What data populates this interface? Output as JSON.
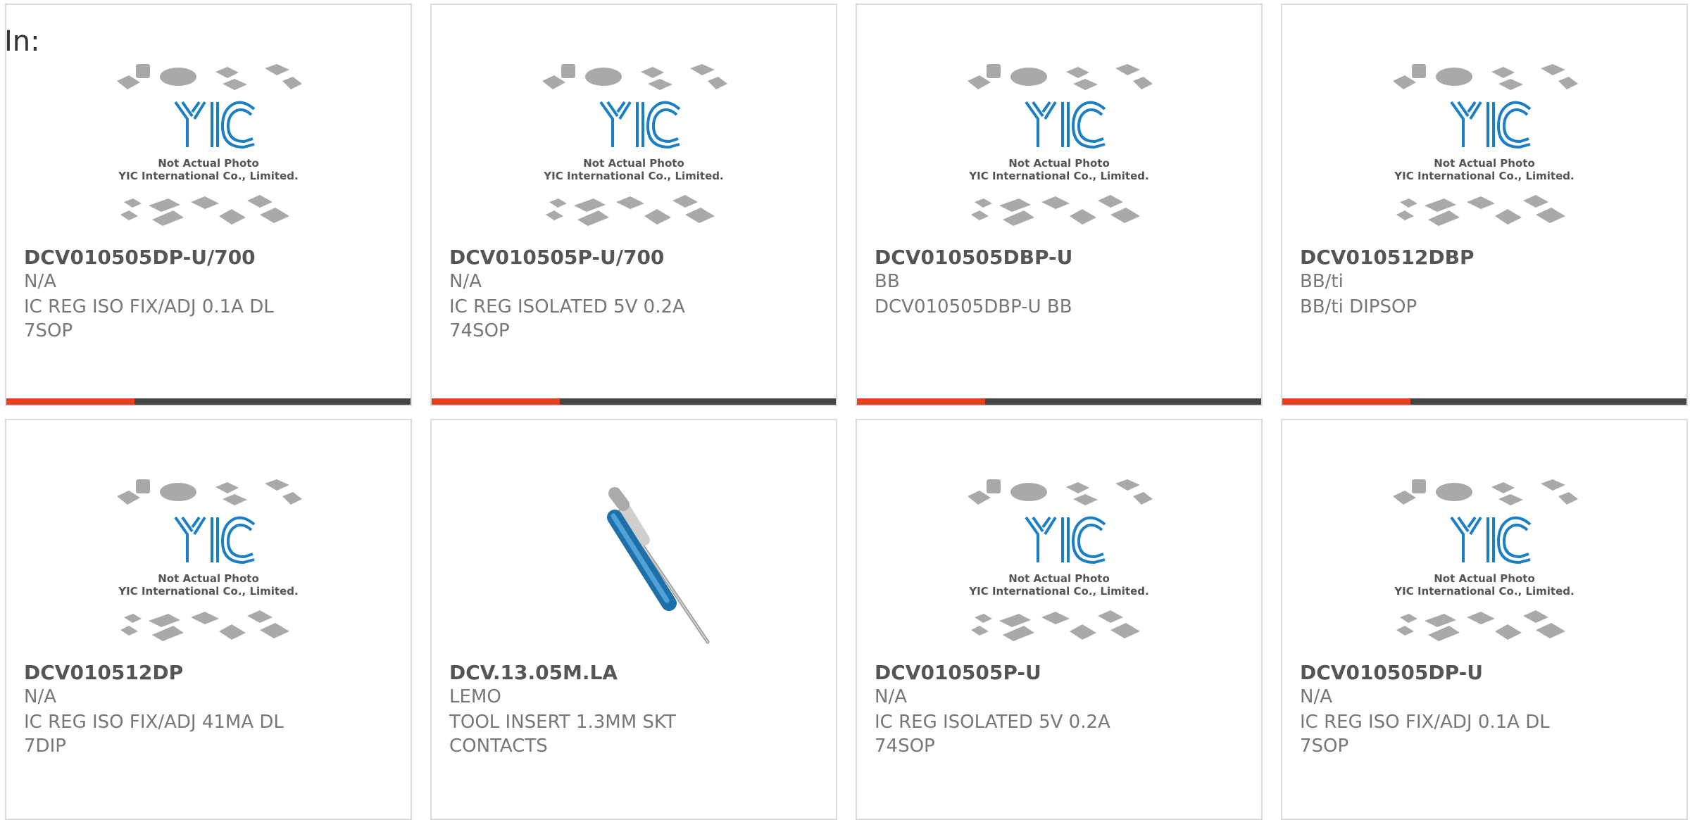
{
  "header": {
    "in_label": "In:"
  },
  "placeholder": {
    "line1": "Not Actual Photo",
    "line2": "YIC International Co., Limited."
  },
  "colors": {
    "accent": "#e6401d",
    "bar": "#444444",
    "border": "#dcdcdc",
    "logo": "#1b7fc4"
  },
  "products": [
    {
      "title": "DCV010505DP-U/700",
      "mfr": "N/A",
      "desc": "IC REG ISO FIX/ADJ 0.1A DL 7SOP",
      "image": "placeholder"
    },
    {
      "title": "DCV010505P-U/700",
      "mfr": "N/A",
      "desc": "IC REG ISOLATED 5V 0.2A 74SOP",
      "image": "placeholder"
    },
    {
      "title": "DCV010505DBP-U",
      "mfr": "BB",
      "desc": "DCV010505DBP-U BB",
      "image": "placeholder"
    },
    {
      "title": "DCV010512DBP",
      "mfr": "BB/ti",
      "desc": "BB/ti DIPSOP",
      "image": "placeholder"
    },
    {
      "title": "DCV010512DP",
      "mfr": "N/A",
      "desc": "IC REG ISO FIX/ADJ 41MA DL 7DIP",
      "image": "placeholder"
    },
    {
      "title": "DCV.13.05M.LA",
      "mfr": "LEMO",
      "desc": "TOOL INSERT 1.3MM SKT CONTACTS",
      "image": "tool-photo"
    },
    {
      "title": "DCV010505P-U",
      "mfr": "N/A",
      "desc": "IC REG ISOLATED 5V 0.2A 74SOP",
      "image": "placeholder"
    },
    {
      "title": "DCV010505DP-U",
      "mfr": "N/A",
      "desc": "IC REG ISO FIX/ADJ 0.1A DL 7SOP",
      "image": "placeholder"
    }
  ]
}
